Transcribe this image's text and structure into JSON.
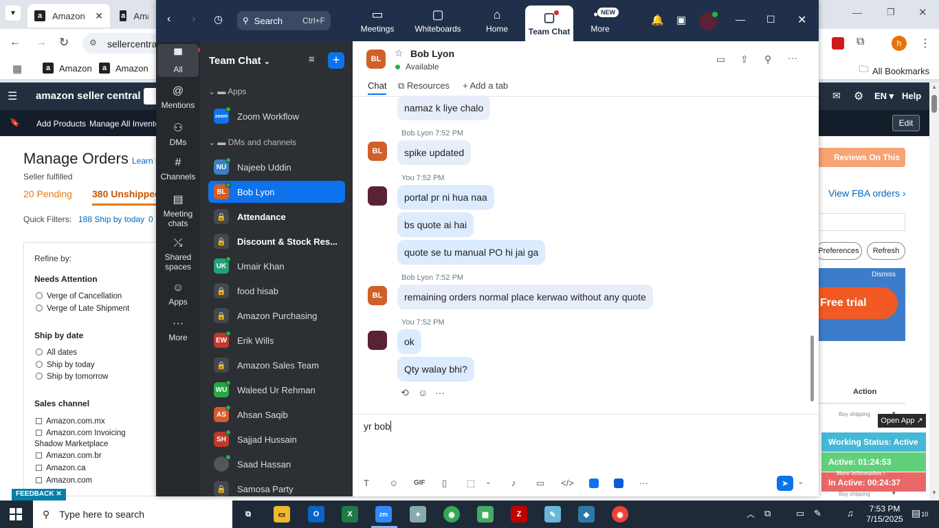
{
  "browser": {
    "tab1_title": "Amazon",
    "tab2_title": "Amaz",
    "url": "sellercentra",
    "bookmarks": [
      "Amazon",
      "Amazon"
    ],
    "all_bookmarks": "All Bookmarks",
    "profile_letter": "h"
  },
  "amazon": {
    "logo": "amazon seller central",
    "lang": "EN",
    "help": "Help",
    "nav": [
      "Add Products",
      "Manage All Inventor"
    ],
    "edit": "Edit",
    "title": "Manage Orders",
    "learn": "Learn m",
    "subtitle": "Seller fulfilled",
    "pending": "20 Pending",
    "unshipped": "380 Unshipped",
    "quick_filters_label": "Quick Filters:",
    "quick_filter": "188 Ship by today",
    "quick_filter_tail": "0",
    "refine": "Refine by:",
    "needs_attention": "Needs Attention",
    "na_options": [
      "Verge of Cancellation",
      "Verge of Late Shipment"
    ],
    "ship_by_date": "Ship by date",
    "sbd_options": [
      "All dates",
      "Ship by today",
      "Ship by tomorrow"
    ],
    "sales_channel": "Sales channel",
    "sc_options": [
      "Amazon.com.mx",
      "Amazon.com Invoicing",
      "Shadow Marketplace",
      "Amazon.com.br",
      "Amazon.ca",
      "Amazon.com"
    ],
    "feedback": "FEEDBACK",
    "reviews": "Reviews On This Page",
    "view_fba": "View FBA orders",
    "preferences": "Preferences",
    "refresh": "Refresh",
    "dismiss": "Dismiss",
    "free_trial": "Free trial",
    "action": "Action",
    "buy_shipping": "Buy shipping",
    "open_app": "Open App",
    "working_status": "Working Status: Active",
    "active_time": "Active: 01:24:53",
    "more_info": "More information",
    "inactive_time": "In Active: 00:24:37"
  },
  "zoom": {
    "search_label": "Search",
    "search_shortcut": "Ctrl+F",
    "tabs": [
      {
        "label": "Meetings",
        "icon": "camera-icon"
      },
      {
        "label": "Whiteboards",
        "icon": "whiteboard-icon"
      },
      {
        "label": "Home",
        "icon": "home-icon"
      },
      {
        "label": "Team Chat",
        "icon": "chat-icon"
      },
      {
        "label": "More",
        "icon": "more-icon"
      }
    ],
    "new_badge": "NEW",
    "rail": [
      {
        "label": "All",
        "icon": "chat-bubble-icon"
      },
      {
        "label": "Mentions",
        "icon": "at-icon"
      },
      {
        "label": "DMs",
        "icon": "people-icon"
      },
      {
        "label": "Channels",
        "icon": "hash-icon"
      },
      {
        "label": "Meeting chats",
        "icon": "calendar-icon"
      },
      {
        "label": "Shared spaces",
        "icon": "share-icon"
      },
      {
        "label": "Apps",
        "icon": "apps-icon"
      },
      {
        "label": "More",
        "icon": "ellipsis-icon"
      }
    ],
    "sidebar_title": "Team Chat",
    "section_apps": "Apps",
    "zoom_workflow": "Zoom Workflow",
    "section_dms": "DMs and channels",
    "contacts": [
      {
        "initials": "NU",
        "name": "Najeeb Uddin",
        "color": "#3b82c4",
        "kind": "dm"
      },
      {
        "initials": "BL",
        "name": "Bob Lyon",
        "color": "#d0602a",
        "kind": "dm",
        "selected": true
      },
      {
        "initials": "",
        "name": "Attendance",
        "kind": "channel",
        "bold": true
      },
      {
        "initials": "",
        "name": "Discount & Stock Res...",
        "kind": "channel",
        "bold": true
      },
      {
        "initials": "UK",
        "name": "Umair Khan",
        "color": "#26a07a",
        "kind": "dm"
      },
      {
        "initials": "",
        "name": "food hisab",
        "kind": "channel"
      },
      {
        "initials": "",
        "name": "Amazon Purchasing",
        "kind": "channel"
      },
      {
        "initials": "EW",
        "name": "Erik Wills",
        "color": "#c0392b",
        "kind": "dm"
      },
      {
        "initials": "",
        "name": "Amazon Sales Team",
        "kind": "channel"
      },
      {
        "initials": "WU",
        "name": "Waleed Ur Rehman",
        "color": "#27a845",
        "kind": "dm"
      },
      {
        "initials": "AS",
        "name": "Ahsan Saqib",
        "color": "#d85a2a",
        "kind": "dm"
      },
      {
        "initials": "SH",
        "name": "Sajjad Hussain",
        "color": "#c0392b",
        "kind": "dm"
      },
      {
        "initials": "",
        "name": "Saad Hassan",
        "color": "#555",
        "kind": "photo"
      },
      {
        "initials": "",
        "name": "Samosa Party",
        "kind": "channel"
      }
    ],
    "chat": {
      "contact_initials": "BL",
      "contact_name": "Bob Lyon",
      "status": "Available",
      "tabs": [
        "Chat",
        "Resources",
        "Add a tab"
      ],
      "messages": [
        {
          "text": "namaz k liye chalo",
          "mine": false
        },
        {
          "meta": "Bob Lyon 7:52 PM",
          "avatar": "BL",
          "text": "spike updated",
          "mine": false
        },
        {
          "meta": "You 7:52 PM",
          "avatar": "you",
          "text": "portal pr ni hua naa",
          "mine": true
        },
        {
          "text": "bs quote ai hai",
          "mine": true
        },
        {
          "text": "quote se tu manual PO hi jai ga",
          "mine": true
        },
        {
          "meta": "Bob Lyon 7:52 PM",
          "avatar": "BL",
          "text": "remaining orders normal place kerwao without any quote",
          "mine": false
        },
        {
          "meta": "You 7:52 PM",
          "avatar": "you",
          "text": "ok",
          "mine": true
        },
        {
          "text": "Qty walay bhi?",
          "mine": true
        }
      ],
      "draft": "yr bob"
    }
  },
  "taskbar": {
    "search_placeholder": "Type here to search",
    "time": "7:53 PM",
    "date": "7/15/2025",
    "notifications": "10"
  }
}
